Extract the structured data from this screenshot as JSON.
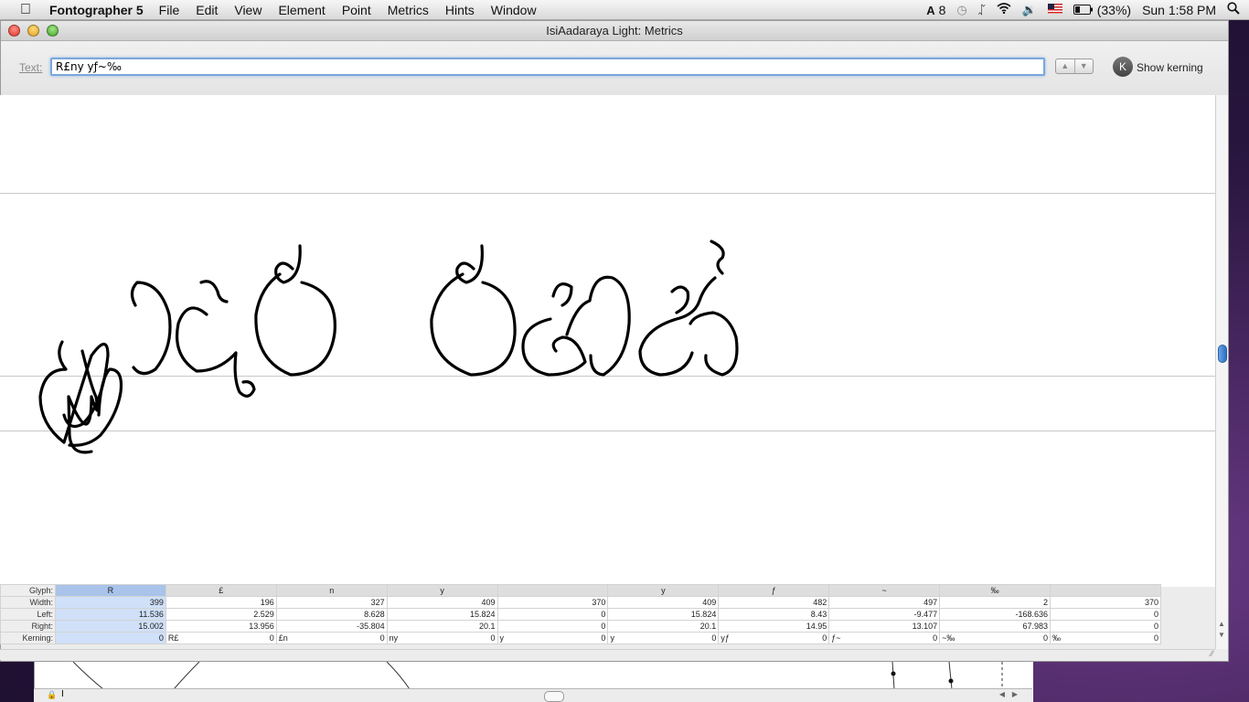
{
  "menubar": {
    "app_name": "Fontographer 5",
    "menus": [
      "File",
      "Edit",
      "View",
      "Element",
      "Point",
      "Metrics",
      "Hints",
      "Window"
    ],
    "status": {
      "adobe_count": "8",
      "battery": "(33%)",
      "clock": "Sun 1:58 PM"
    }
  },
  "window": {
    "title": "IsiAadaraya Light: Metrics"
  },
  "toolbar": {
    "text_label": "Text:",
    "text_value": "R£ny yƒ~‰",
    "show_kerning_label": "Show kerning",
    "kerning_button_letter": "K"
  },
  "metrics": {
    "row_labels": [
      "Glyph:",
      "Width:",
      "Left:",
      "Right:",
      "Kerning:"
    ],
    "columns": [
      {
        "glyph": "R",
        "width": "399",
        "left": "11.536",
        "right": "15.002",
        "pair": "",
        "kern": "0"
      },
      {
        "glyph": "£",
        "width": "196",
        "left": "2.529",
        "right": "13.956",
        "pair": "R£",
        "kern": "0"
      },
      {
        "glyph": "n",
        "width": "327",
        "left": "8.628",
        "right": "-35.804",
        "pair": "£n",
        "kern": "0"
      },
      {
        "glyph": "y",
        "width": "409",
        "left": "15.824",
        "right": "20.1",
        "pair": "ny",
        "kern": "0"
      },
      {
        "glyph": "",
        "width": "370",
        "left": "0",
        "right": "0",
        "pair": "y",
        "kern": "0"
      },
      {
        "glyph": "y",
        "width": "409",
        "left": "15.824",
        "right": "20.1",
        "pair": "y",
        "kern": "0"
      },
      {
        "glyph": "ƒ",
        "width": "482",
        "left": "8.43",
        "right": "14.95",
        "pair": "yƒ",
        "kern": "0"
      },
      {
        "glyph": "~",
        "width": "497",
        "left": "-9.477",
        "right": "13.107",
        "pair": "ƒ~",
        "kern": "0"
      },
      {
        "glyph": "‰",
        "width": "2",
        "left": "-168.636",
        "right": "67.983",
        "pair": "~‰",
        "kern": "0"
      },
      {
        "glyph": "",
        "width": "370",
        "left": "0",
        "right": "0",
        "pair": "‰",
        "kern": "0"
      }
    ]
  },
  "colors": {
    "selection": "#a9c3ea",
    "accent": "#3b7dd8"
  }
}
